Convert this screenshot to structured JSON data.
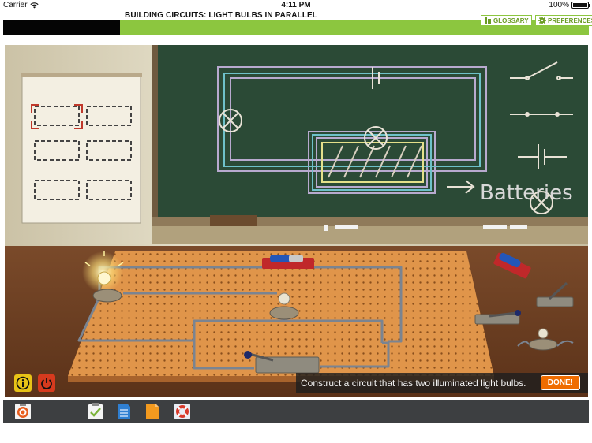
{
  "status_bar": {
    "carrier": "Carrier",
    "time": "4:11 PM",
    "battery": "100%"
  },
  "header": {
    "title": "BUILDING CIRCUITS: LIGHT BULBS IN PARALLEL",
    "progress": 0.2,
    "glossary_label": "GLOSSARY",
    "preferences_label": "PREFERENCES"
  },
  "chalkboard": {
    "label": "Batteries"
  },
  "task": {
    "instruction": "Construct a circuit that has two illuminated light bulbs.",
    "done_label": "DONE!"
  },
  "colors": {
    "accent": "#8cc63f",
    "done": "#ef6c00",
    "info": "#e8c317",
    "power": "#d63a1e",
    "chalkboard": "#2b4a36",
    "pegboard": "#e0954a"
  },
  "toolbar": {
    "items": [
      {
        "icon": "target-icon"
      },
      {
        "icon": "checklist-icon"
      },
      {
        "icon": "notes-icon"
      },
      {
        "icon": "document-icon"
      },
      {
        "icon": "lifebuoy-icon"
      }
    ]
  }
}
